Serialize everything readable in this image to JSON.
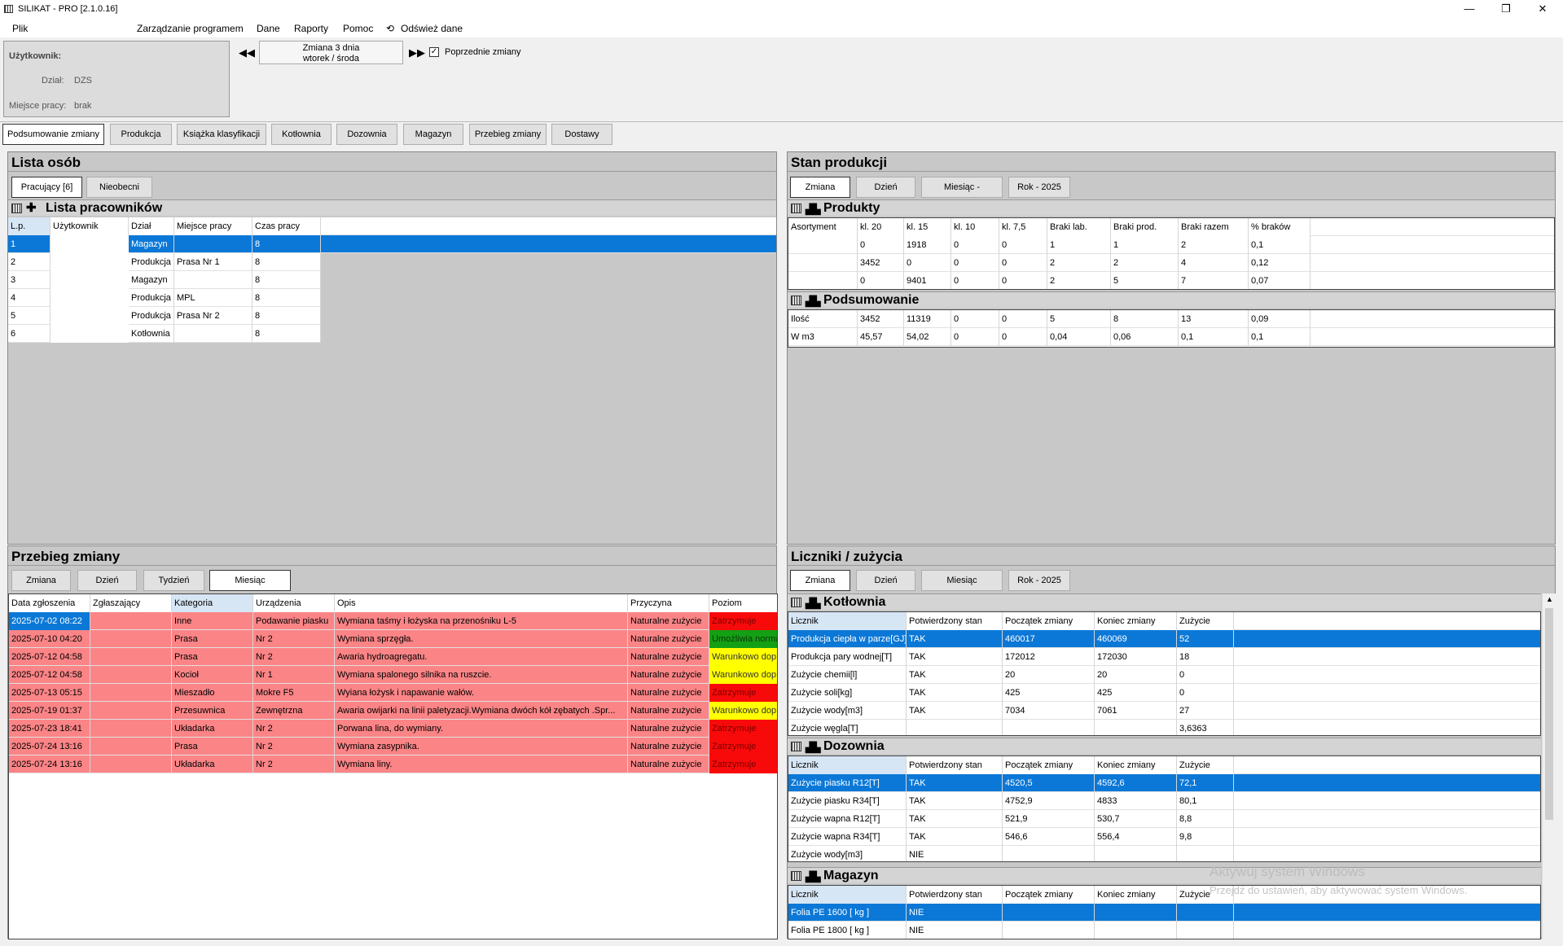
{
  "title": "SILIKAT - PRO [2.1.0.16]",
  "window_controls": {
    "minimize": "—",
    "restore": "❐",
    "close": "✕"
  },
  "menu": [
    "Plik",
    "Zarządzanie programem",
    "Dane",
    "Raporty",
    "Pomoc",
    "Odśwież dane"
  ],
  "user": {
    "label": "Użytkownik:",
    "dept_label": "Dział:",
    "dept": "DZS",
    "place_label": "Miejsce pracy:",
    "place": "brak"
  },
  "shift": {
    "line1": "Zmiana 3 dnia",
    "line2": "wtorek / środa",
    "prev_label": "Poprzednie zmiany",
    "prev_checked": true
  },
  "tabs": [
    "Podsumowanie zmiany",
    "Produkcja",
    "Książka klasyfikacji",
    "Kotłownia",
    "Dozownia",
    "Magazyn",
    "Przebieg zmiany",
    "Dostawy"
  ],
  "lista_osob": {
    "title": "Lista osób",
    "buttons": [
      "Pracujący [6]",
      "Nieobecni"
    ],
    "section": "Lista pracowników",
    "columns": [
      "L.p.",
      "Użytkownik",
      "Dział",
      "Miejsce pracy",
      "Czas pracy"
    ],
    "rows": [
      [
        "1",
        "",
        "Magazyn",
        "",
        "8"
      ],
      [
        "2",
        "",
        "Produkcja",
        "Prasa Nr 1",
        "8"
      ],
      [
        "3",
        "",
        "Magazyn",
        "",
        "8"
      ],
      [
        "4",
        "",
        "Produkcja",
        "MPL",
        "8"
      ],
      [
        "5",
        "",
        "Produkcja",
        "Prasa Nr 2",
        "8"
      ],
      [
        "6",
        "",
        "Kotłownia",
        "",
        "8"
      ]
    ]
  },
  "stan_produkcji": {
    "title": "Stan produkcji",
    "buttons": [
      "Zmiana",
      "Dzień",
      "Miesiąc -",
      "Rok - 2025"
    ],
    "produkty_title": "Produkty",
    "columns": [
      "Asortyment",
      "kl. 20",
      "kl. 15",
      "kl. 10",
      "kl. 7,5",
      "Braki lab.",
      "Braki prod.",
      "Braki razem",
      "% braków"
    ],
    "rows": [
      [
        "",
        "0",
        "1918",
        "0",
        "0",
        "1",
        "1",
        "2",
        "0,1"
      ],
      [
        "",
        "3452",
        "0",
        "0",
        "0",
        "2",
        "2",
        "4",
        "0,12"
      ],
      [
        "",
        "0",
        "9401",
        "0",
        "0",
        "2",
        "5",
        "7",
        "0,07"
      ]
    ],
    "podsumowanie_title": "Podsumowanie",
    "summary": [
      [
        "Ilość",
        "3452",
        "11319",
        "0",
        "0",
        "5",
        "8",
        "13",
        "0,09"
      ],
      [
        "W m3",
        "45,57",
        "54,02",
        "0",
        "0",
        "0,04",
        "0,06",
        "0,1",
        "0,1"
      ]
    ]
  },
  "przebieg": {
    "title": "Przebieg zmiany",
    "buttons": [
      "Zmiana",
      "Dzień",
      "Tydzień",
      "Miesiąc"
    ],
    "columns": [
      "Data zgłoszenia",
      "Zgłaszający",
      "Kategoria",
      "Urządzenia",
      "Opis",
      "Przyczyna",
      "Poziom"
    ],
    "rows": [
      {
        "c": [
          "2025-07-02 08:22",
          "",
          "Inne",
          "Podawanie piasku",
          "Wymiana taśmy i łożyska na przenośniku L-5",
          "Naturalne zużycie",
          "Zatrzymuje"
        ],
        "lv": "red"
      },
      {
        "c": [
          "2025-07-10 04:20",
          "",
          "Prasa",
          "Nr 2",
          "Wymiana sprzęgła.",
          "Naturalne zużycie",
          "Umożliwia normal..."
        ],
        "lv": "green"
      },
      {
        "c": [
          "2025-07-12 04:58",
          "",
          "Prasa",
          "Nr 2",
          "Awaria hydroagregatu.",
          "Naturalne zużycie",
          "Warunkowo dop..."
        ],
        "lv": "yellow"
      },
      {
        "c": [
          "2025-07-12 04:58",
          "",
          "Kocioł",
          "Nr 1",
          "Wymiana spalonego silnika na ruszcie.",
          "Naturalne zużycie",
          "Warunkowo dop..."
        ],
        "lv": "yellow"
      },
      {
        "c": [
          "2025-07-13 05:15",
          "",
          "Mieszadło",
          "Mokre F5",
          "Wyiana łożysk i napawanie wałów.",
          "Naturalne zużycie",
          "Zatrzymuje"
        ],
        "lv": "red"
      },
      {
        "c": [
          "2025-07-19 01:37",
          "",
          "Przesuwnica",
          "Zewnętrzna",
          "Awaria owijarki na linii paletyzacji.Wymiana dwóch kół zębatych .Spr...",
          "Naturalne zużycie",
          "Warunkowo dop..."
        ],
        "lv": "yellow"
      },
      {
        "c": [
          "2025-07-23 18:41",
          "",
          "Układarka",
          "Nr 2",
          "Porwana lina, do wymiany.",
          "Naturalne zużycie",
          "Zatrzymuje"
        ],
        "lv": "red"
      },
      {
        "c": [
          "2025-07-24 13:16",
          "",
          "Prasa",
          "Nr 2",
          "Wymiana zasypnika.",
          "Naturalne zużycie",
          "Zatrzymuje"
        ],
        "lv": "red"
      },
      {
        "c": [
          "2025-07-24 13:16",
          "",
          "Układarka",
          "Nr 2",
          "Wymiana liny.",
          "Naturalne zużycie",
          "Zatrzymuje"
        ],
        "lv": "red"
      }
    ]
  },
  "liczniki": {
    "title": "Liczniki / zużycia",
    "buttons": [
      "Zmiana",
      "Dzień",
      "Miesiąc",
      "Rok - 2025"
    ],
    "columns": [
      "Licznik",
      "Potwierdzony stan",
      "Początek zmiany",
      "Koniec zmiany",
      "Zużycie"
    ],
    "kotlownia_title": "Kotłownia",
    "kotlownia": [
      [
        "Produkcja ciepła w parze[GJ]",
        "TAK",
        "460017",
        "460069",
        "52"
      ],
      [
        "Produkcja pary wodnej[T]",
        "TAK",
        "172012",
        "172030",
        "18"
      ],
      [
        "Zużycie chemii[l]",
        "TAK",
        "20",
        "20",
        "0"
      ],
      [
        "Zużycie soli[kg]",
        "TAK",
        "425",
        "425",
        "0"
      ],
      [
        "Zużycie wody[m3]",
        "TAK",
        "7034",
        "7061",
        "27"
      ],
      [
        "Zużycie węgla[T]",
        "",
        "",
        "",
        "3,6363"
      ]
    ],
    "dozownia_title": "Dozownia",
    "dozownia": [
      [
        "Zużycie piasku R12[T]",
        "TAK",
        "4520,5",
        "4592,6",
        "72,1"
      ],
      [
        "Zużycie piasku R34[T]",
        "TAK",
        "4752,9",
        "4833",
        "80,1"
      ],
      [
        "Zużycie wapna R12[T]",
        "TAK",
        "521,9",
        "530,7",
        "8,8"
      ],
      [
        "Zużycie wapna R34[T]",
        "TAK",
        "546,6",
        "556,4",
        "9,8"
      ],
      [
        "Zużycie wody[m3]",
        "NIE",
        "",
        "",
        ""
      ]
    ],
    "magazyn_title": "Magazyn",
    "magazyn": [
      [
        "Folia PE 1600 [ kg ]",
        "NIE",
        "",
        "",
        ""
      ],
      [
        "Folia PE 1800 [ kg ]",
        "NIE",
        "",
        "",
        ""
      ]
    ]
  },
  "watermark": {
    "line1": "Aktywuj system Windows",
    "line2": "Przejdź do ustawień, aby aktywować system Windows."
  }
}
